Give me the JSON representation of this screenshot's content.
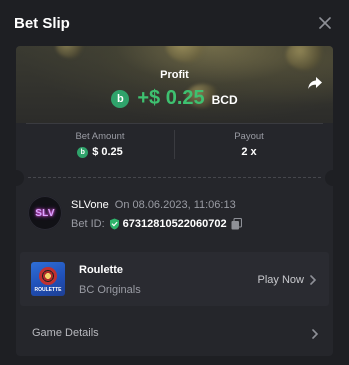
{
  "header": {
    "title": "Bet Slip"
  },
  "profit": {
    "label": "Profit",
    "coin_symbol": "b",
    "value": "+$ 0.25",
    "currency": "BCD"
  },
  "stats": {
    "bet_amount_label": "Bet Amount",
    "bet_amount_value": "$ 0.25",
    "payout_label": "Payout",
    "payout_value": "2 x"
  },
  "user": {
    "avatar_text": "SLV",
    "name": "SLVone",
    "date_text": "On 08.06.2023, 11:06:13",
    "bet_id_label": "Bet ID:",
    "bet_id": "67312810522060702"
  },
  "game": {
    "thumb_text": "ROULETTE",
    "name": "Roulette",
    "provider": "BC Originals",
    "action": "Play Now"
  },
  "details": {
    "label": "Game Details"
  },
  "colors": {
    "profit_green": "#3ec170",
    "coin_green": "#2fa36b",
    "background": "#1e1f23",
    "card": "#25262b"
  }
}
